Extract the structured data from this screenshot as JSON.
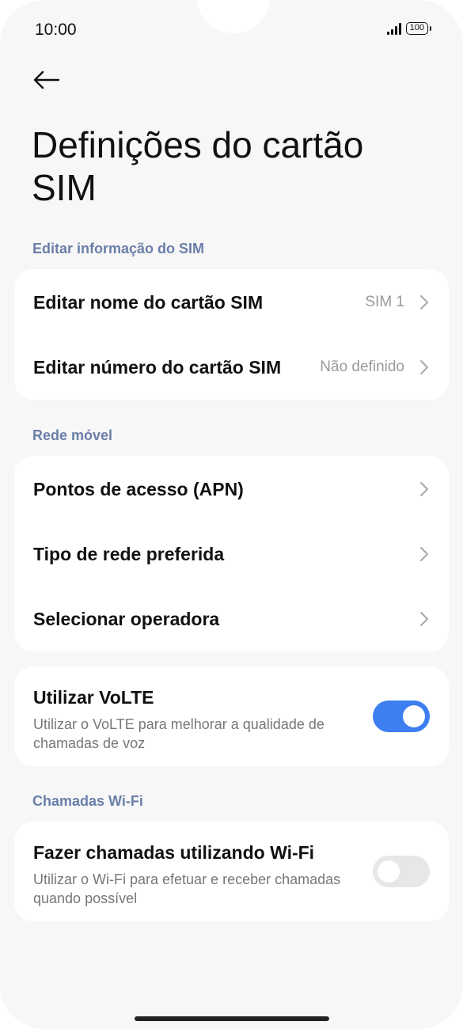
{
  "status_bar": {
    "time": "10:00",
    "battery": "100"
  },
  "page": {
    "title": "Definições do cartão SIM"
  },
  "sections": {
    "sim_info": {
      "label": "Editar informação do SIM",
      "items": [
        {
          "title": "Editar nome do cartão SIM",
          "value": "SIM 1"
        },
        {
          "title": "Editar número do cartão SIM",
          "value": "Não definido"
        }
      ]
    },
    "mobile_network": {
      "label": "Rede móvel",
      "items": [
        {
          "title": "Pontos de acesso (APN)"
        },
        {
          "title": "Tipo de rede preferida"
        },
        {
          "title": "Selecionar operadora"
        }
      ]
    },
    "volte": {
      "title": "Utilizar VoLTE",
      "description": "Utilizar o VoLTE para melhorar a qualidade de chamadas de voz",
      "enabled": true
    },
    "wifi_calling": {
      "label": "Chamadas Wi-Fi",
      "title": "Fazer chamadas utilizando Wi-Fi",
      "description": "Utilizar o Wi-Fi para efetuar e receber chamadas quando possível",
      "enabled": false
    }
  },
  "colors": {
    "accent": "#3d7ef0",
    "section_label": "#6a7fa8",
    "background": "#f7f7f7"
  },
  "icons": {
    "back": "arrow-left-icon",
    "chevron": "chevron-right-icon"
  }
}
